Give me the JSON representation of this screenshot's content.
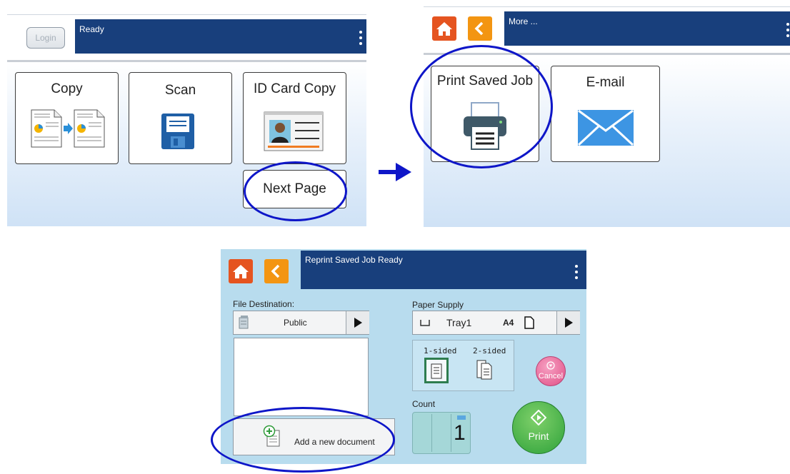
{
  "panel1": {
    "login_label": "Login",
    "status": "Ready",
    "tiles": {
      "copy": "Copy",
      "scan": "Scan",
      "id_card_copy": "ID Card Copy",
      "next_page": "Next Page"
    }
  },
  "panel2": {
    "title": "More ...",
    "tiles": {
      "print_saved_job": "Print Saved Job",
      "email": "E-mail"
    }
  },
  "panel3": {
    "title": "Reprint Saved Job  Ready",
    "file_destination_label": "File Destination:",
    "destination_value": "Public",
    "add_document_label": "Add a new document",
    "paper_supply_label": "Paper Supply",
    "tray_value": "Tray1",
    "paper_size": "A4",
    "one_sided_label": "1-sided",
    "two_sided_label": "2-sided",
    "cancel_label": "Cancel",
    "count_label": "Count",
    "count_value": "1",
    "print_label": "Print"
  },
  "icons": [
    "home-icon",
    "back-icon",
    "more-icon",
    "copy-icon",
    "scan-icon",
    "id-card-icon",
    "printer-icon",
    "email-icon",
    "folder-icon",
    "add-document-icon",
    "tray-icon",
    "portrait-page-icon",
    "one-sided-icon",
    "two-sided-icon",
    "cancel-icon",
    "print-icon",
    "flow-arrow-icon"
  ],
  "colors": {
    "title_bar": "#183f7c",
    "home_button": "#e55420",
    "back_button": "#f39512",
    "panel3_background": "#b8dcee",
    "print_button": "#3cae3a",
    "cancel_button": "#ea5c93",
    "highlight_ring": "#0e16c8"
  }
}
